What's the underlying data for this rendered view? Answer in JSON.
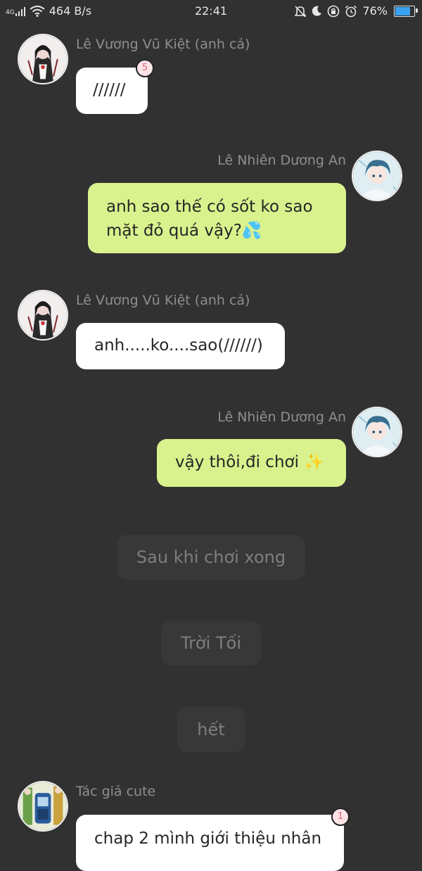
{
  "status_bar": {
    "network": "4G",
    "speed": "464 B/s",
    "time": "22:41",
    "battery": "76%",
    "battery_level": 0.76,
    "icons": [
      "signal-icon",
      "wifi-icon",
      "bell-muted-icon",
      "moon-icon",
      "rotation-lock-icon",
      "alarm-icon",
      "battery-icon"
    ]
  },
  "messages": [
    {
      "sender": "Lê Vương Vũ Kiệt (anh cả)",
      "text": "//////",
      "side": "left",
      "badge": "5"
    },
    {
      "sender": "Lê Nhiên Dương An",
      "text_line1": "anh sao thế có sốt ko sao",
      "text_line2": "mặt đỏ quá vậy?💦",
      "side": "right"
    },
    {
      "sender": "Lê Vương Vũ Kiệt (anh cả)",
      "text": "anh.....ko....sao(//////)",
      "side": "left"
    },
    {
      "sender": "Lê Nhiên Dương An",
      "text": "vậy thôi,đi chơi ✨",
      "side": "right"
    },
    {
      "sender": "Tác giả cute",
      "text": "chap 2 mình giới thiệu nhân",
      "side": "left",
      "badge": "1"
    }
  ],
  "narrations": [
    "Sau khi chơi xong",
    "Trời Tối",
    "hết"
  ],
  "colors": {
    "background": "#313131",
    "bubble_white": "#ffffff",
    "bubble_green": "#d9f28d",
    "sender_name": "#8f8f8f",
    "narration_bg": "#383838",
    "narration_text": "#7e7e7e",
    "badge_text": "#e0677d"
  }
}
